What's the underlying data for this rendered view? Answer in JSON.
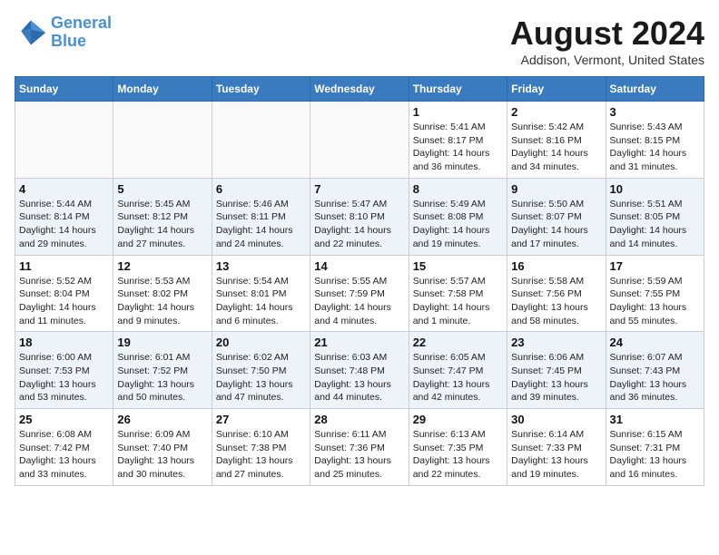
{
  "header": {
    "logo_line1": "General",
    "logo_line2": "Blue",
    "month_title": "August 2024",
    "location": "Addison, Vermont, United States"
  },
  "days_of_week": [
    "Sunday",
    "Monday",
    "Tuesday",
    "Wednesday",
    "Thursday",
    "Friday",
    "Saturday"
  ],
  "weeks": [
    [
      {
        "day": "",
        "info": ""
      },
      {
        "day": "",
        "info": ""
      },
      {
        "day": "",
        "info": ""
      },
      {
        "day": "",
        "info": ""
      },
      {
        "day": "1",
        "info": "Sunrise: 5:41 AM\nSunset: 8:17 PM\nDaylight: 14 hours\nand 36 minutes."
      },
      {
        "day": "2",
        "info": "Sunrise: 5:42 AM\nSunset: 8:16 PM\nDaylight: 14 hours\nand 34 minutes."
      },
      {
        "day": "3",
        "info": "Sunrise: 5:43 AM\nSunset: 8:15 PM\nDaylight: 14 hours\nand 31 minutes."
      }
    ],
    [
      {
        "day": "4",
        "info": "Sunrise: 5:44 AM\nSunset: 8:14 PM\nDaylight: 14 hours\nand 29 minutes."
      },
      {
        "day": "5",
        "info": "Sunrise: 5:45 AM\nSunset: 8:12 PM\nDaylight: 14 hours\nand 27 minutes."
      },
      {
        "day": "6",
        "info": "Sunrise: 5:46 AM\nSunset: 8:11 PM\nDaylight: 14 hours\nand 24 minutes."
      },
      {
        "day": "7",
        "info": "Sunrise: 5:47 AM\nSunset: 8:10 PM\nDaylight: 14 hours\nand 22 minutes."
      },
      {
        "day": "8",
        "info": "Sunrise: 5:49 AM\nSunset: 8:08 PM\nDaylight: 14 hours\nand 19 minutes."
      },
      {
        "day": "9",
        "info": "Sunrise: 5:50 AM\nSunset: 8:07 PM\nDaylight: 14 hours\nand 17 minutes."
      },
      {
        "day": "10",
        "info": "Sunrise: 5:51 AM\nSunset: 8:05 PM\nDaylight: 14 hours\nand 14 minutes."
      }
    ],
    [
      {
        "day": "11",
        "info": "Sunrise: 5:52 AM\nSunset: 8:04 PM\nDaylight: 14 hours\nand 11 minutes."
      },
      {
        "day": "12",
        "info": "Sunrise: 5:53 AM\nSunset: 8:02 PM\nDaylight: 14 hours\nand 9 minutes."
      },
      {
        "day": "13",
        "info": "Sunrise: 5:54 AM\nSunset: 8:01 PM\nDaylight: 14 hours\nand 6 minutes."
      },
      {
        "day": "14",
        "info": "Sunrise: 5:55 AM\nSunset: 7:59 PM\nDaylight: 14 hours\nand 4 minutes."
      },
      {
        "day": "15",
        "info": "Sunrise: 5:57 AM\nSunset: 7:58 PM\nDaylight: 14 hours\nand 1 minute."
      },
      {
        "day": "16",
        "info": "Sunrise: 5:58 AM\nSunset: 7:56 PM\nDaylight: 13 hours\nand 58 minutes."
      },
      {
        "day": "17",
        "info": "Sunrise: 5:59 AM\nSunset: 7:55 PM\nDaylight: 13 hours\nand 55 minutes."
      }
    ],
    [
      {
        "day": "18",
        "info": "Sunrise: 6:00 AM\nSunset: 7:53 PM\nDaylight: 13 hours\nand 53 minutes."
      },
      {
        "day": "19",
        "info": "Sunrise: 6:01 AM\nSunset: 7:52 PM\nDaylight: 13 hours\nand 50 minutes."
      },
      {
        "day": "20",
        "info": "Sunrise: 6:02 AM\nSunset: 7:50 PM\nDaylight: 13 hours\nand 47 minutes."
      },
      {
        "day": "21",
        "info": "Sunrise: 6:03 AM\nSunset: 7:48 PM\nDaylight: 13 hours\nand 44 minutes."
      },
      {
        "day": "22",
        "info": "Sunrise: 6:05 AM\nSunset: 7:47 PM\nDaylight: 13 hours\nand 42 minutes."
      },
      {
        "day": "23",
        "info": "Sunrise: 6:06 AM\nSunset: 7:45 PM\nDaylight: 13 hours\nand 39 minutes."
      },
      {
        "day": "24",
        "info": "Sunrise: 6:07 AM\nSunset: 7:43 PM\nDaylight: 13 hours\nand 36 minutes."
      }
    ],
    [
      {
        "day": "25",
        "info": "Sunrise: 6:08 AM\nSunset: 7:42 PM\nDaylight: 13 hours\nand 33 minutes."
      },
      {
        "day": "26",
        "info": "Sunrise: 6:09 AM\nSunset: 7:40 PM\nDaylight: 13 hours\nand 30 minutes."
      },
      {
        "day": "27",
        "info": "Sunrise: 6:10 AM\nSunset: 7:38 PM\nDaylight: 13 hours\nand 27 minutes."
      },
      {
        "day": "28",
        "info": "Sunrise: 6:11 AM\nSunset: 7:36 PM\nDaylight: 13 hours\nand 25 minutes."
      },
      {
        "day": "29",
        "info": "Sunrise: 6:13 AM\nSunset: 7:35 PM\nDaylight: 13 hours\nand 22 minutes."
      },
      {
        "day": "30",
        "info": "Sunrise: 6:14 AM\nSunset: 7:33 PM\nDaylight: 13 hours\nand 19 minutes."
      },
      {
        "day": "31",
        "info": "Sunrise: 6:15 AM\nSunset: 7:31 PM\nDaylight: 13 hours\nand 16 minutes."
      }
    ]
  ]
}
